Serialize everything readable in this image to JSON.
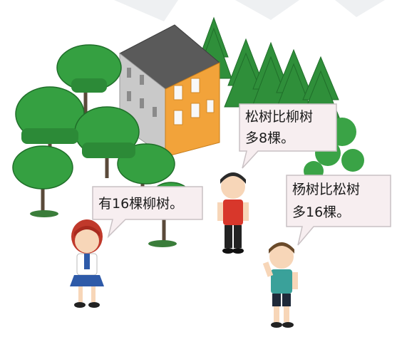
{
  "speech": {
    "girl": "有16棵柳树。",
    "boy_red_line1": "松树比柳树",
    "boy_red_line2": "多8棵。",
    "boy_green_line1": "杨树比松树",
    "boy_green_line2": "多16棵。"
  },
  "colors": {
    "tree_green": "#2e9b3a",
    "tree_dark": "#1f6e29",
    "building_orange": "#f2a33a",
    "building_gray": "#cfcfcf",
    "roof": "#5a5a5a",
    "bubble_fill": "#f7eef0",
    "bubble_stroke": "#c9c1c4"
  }
}
